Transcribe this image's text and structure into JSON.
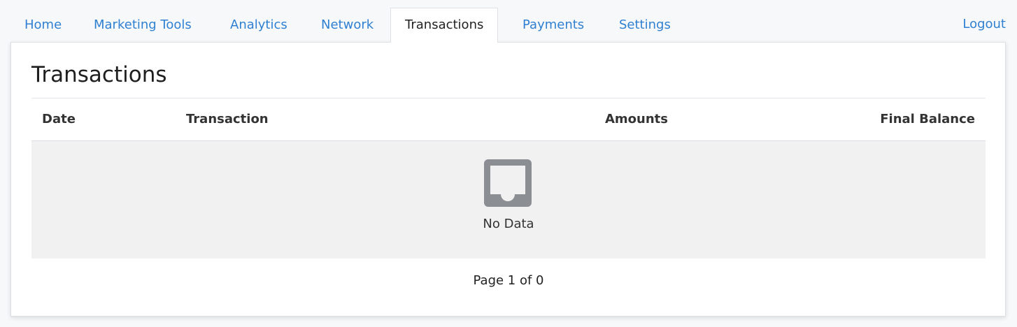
{
  "nav": {
    "tabs": [
      {
        "label": "Home"
      },
      {
        "label": "Marketing Tools"
      },
      {
        "label": "Analytics"
      },
      {
        "label": "Network"
      },
      {
        "label": "Transactions"
      },
      {
        "label": "Payments"
      },
      {
        "label": "Settings"
      }
    ],
    "active_tab": "Transactions",
    "logout_label": "Logout"
  },
  "page": {
    "title": "Transactions"
  },
  "table": {
    "columns": [
      "Date",
      "Transaction",
      "Amounts",
      "Final Balance"
    ],
    "rows": [],
    "empty_text": "No Data"
  },
  "pagination": {
    "text": "Page 1 of 0"
  },
  "icons": {
    "empty_state": "inbox-icon"
  },
  "colors": {
    "link": "#2f80d1",
    "empty_bg": "#f1f1f1",
    "icon": "#8b8f94"
  }
}
